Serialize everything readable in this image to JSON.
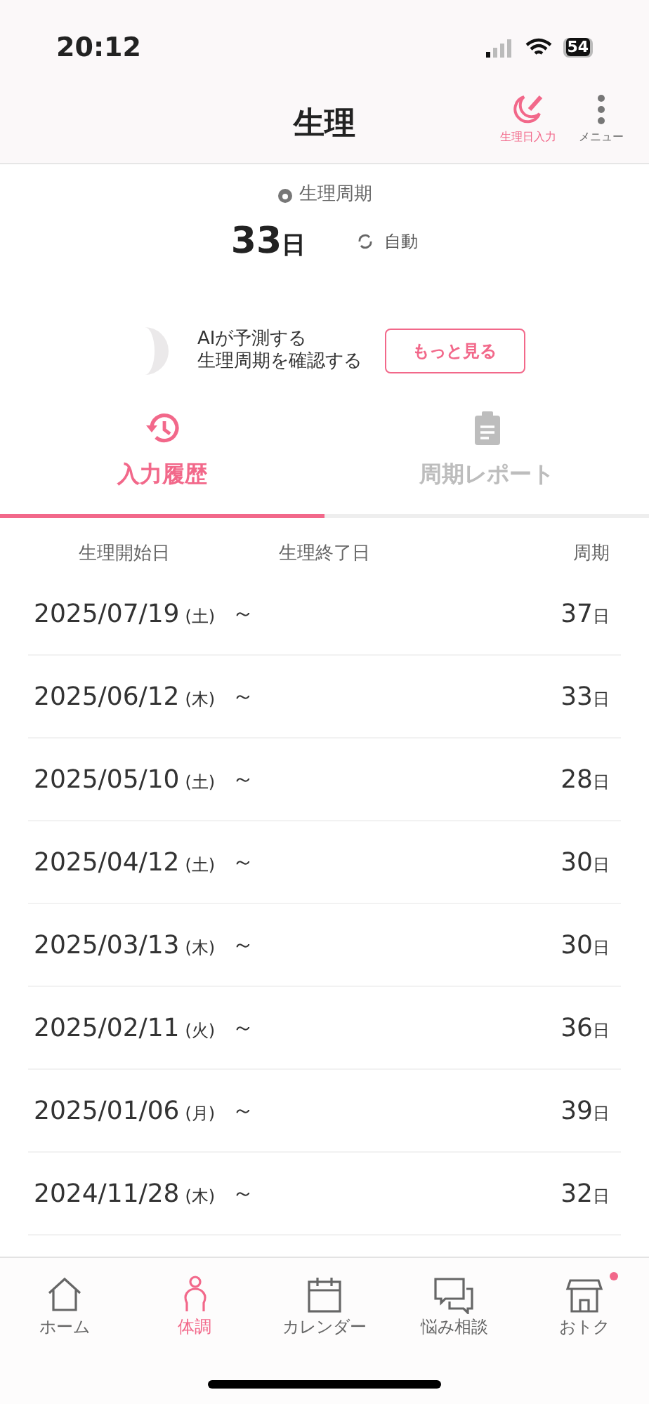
{
  "status_bar": {
    "time": "20:12",
    "battery": "54"
  },
  "header": {
    "title": "生理",
    "actions": [
      {
        "kind": "pen",
        "label": "生理日入力"
      },
      {
        "kind": "menu",
        "label": "メニュー"
      }
    ]
  },
  "summary": {
    "label": "生理周期",
    "value": "33",
    "unit": "日",
    "mode": "自動"
  },
  "ai_banner": {
    "lines": [
      "AIが予測する",
      "生理周期を確認する"
    ],
    "button": "もっと見る"
  },
  "tabs": [
    {
      "kind": "history",
      "label": "入力履歴",
      "selected": true
    },
    {
      "kind": "report",
      "label": "周期レポート",
      "selected": false
    }
  ],
  "table": {
    "columns": [
      "生理開始日",
      "生理終了日",
      "周期"
    ],
    "rows": [
      {
        "date": "2025/07/19",
        "weekday": "(土)",
        "separator": "～",
        "cycle": "37",
        "unit": "日"
      },
      {
        "date": "2025/06/12",
        "weekday": "(木)",
        "separator": "～",
        "cycle": "33",
        "unit": "日"
      },
      {
        "date": "2025/05/10",
        "weekday": "(土)",
        "separator": "～",
        "cycle": "28",
        "unit": "日"
      },
      {
        "date": "2025/04/12",
        "weekday": "(土)",
        "separator": "～",
        "cycle": "30",
        "unit": "日"
      },
      {
        "date": "2025/03/13",
        "weekday": "(木)",
        "separator": "～",
        "cycle": "30",
        "unit": "日"
      },
      {
        "date": "2025/02/11",
        "weekday": "(火)",
        "separator": "～",
        "cycle": "36",
        "unit": "日"
      },
      {
        "date": "2025/01/06",
        "weekday": "(月)",
        "separator": "～",
        "cycle": "39",
        "unit": "日"
      },
      {
        "date": "2024/11/28",
        "weekday": "(木)",
        "separator": "～",
        "cycle": "32",
        "unit": "日"
      }
    ]
  },
  "bottom_nav": [
    {
      "kind": "home",
      "label": "ホーム",
      "selected": false,
      "badge": false
    },
    {
      "kind": "body",
      "label": "体調",
      "selected": true,
      "badge": false
    },
    {
      "kind": "calendar",
      "label": "カレンダー",
      "selected": false,
      "badge": false
    },
    {
      "kind": "chat",
      "label": "悩み相談",
      "selected": false,
      "badge": false
    },
    {
      "kind": "shop",
      "label": "おトク",
      "selected": false,
      "badge": true
    }
  ]
}
